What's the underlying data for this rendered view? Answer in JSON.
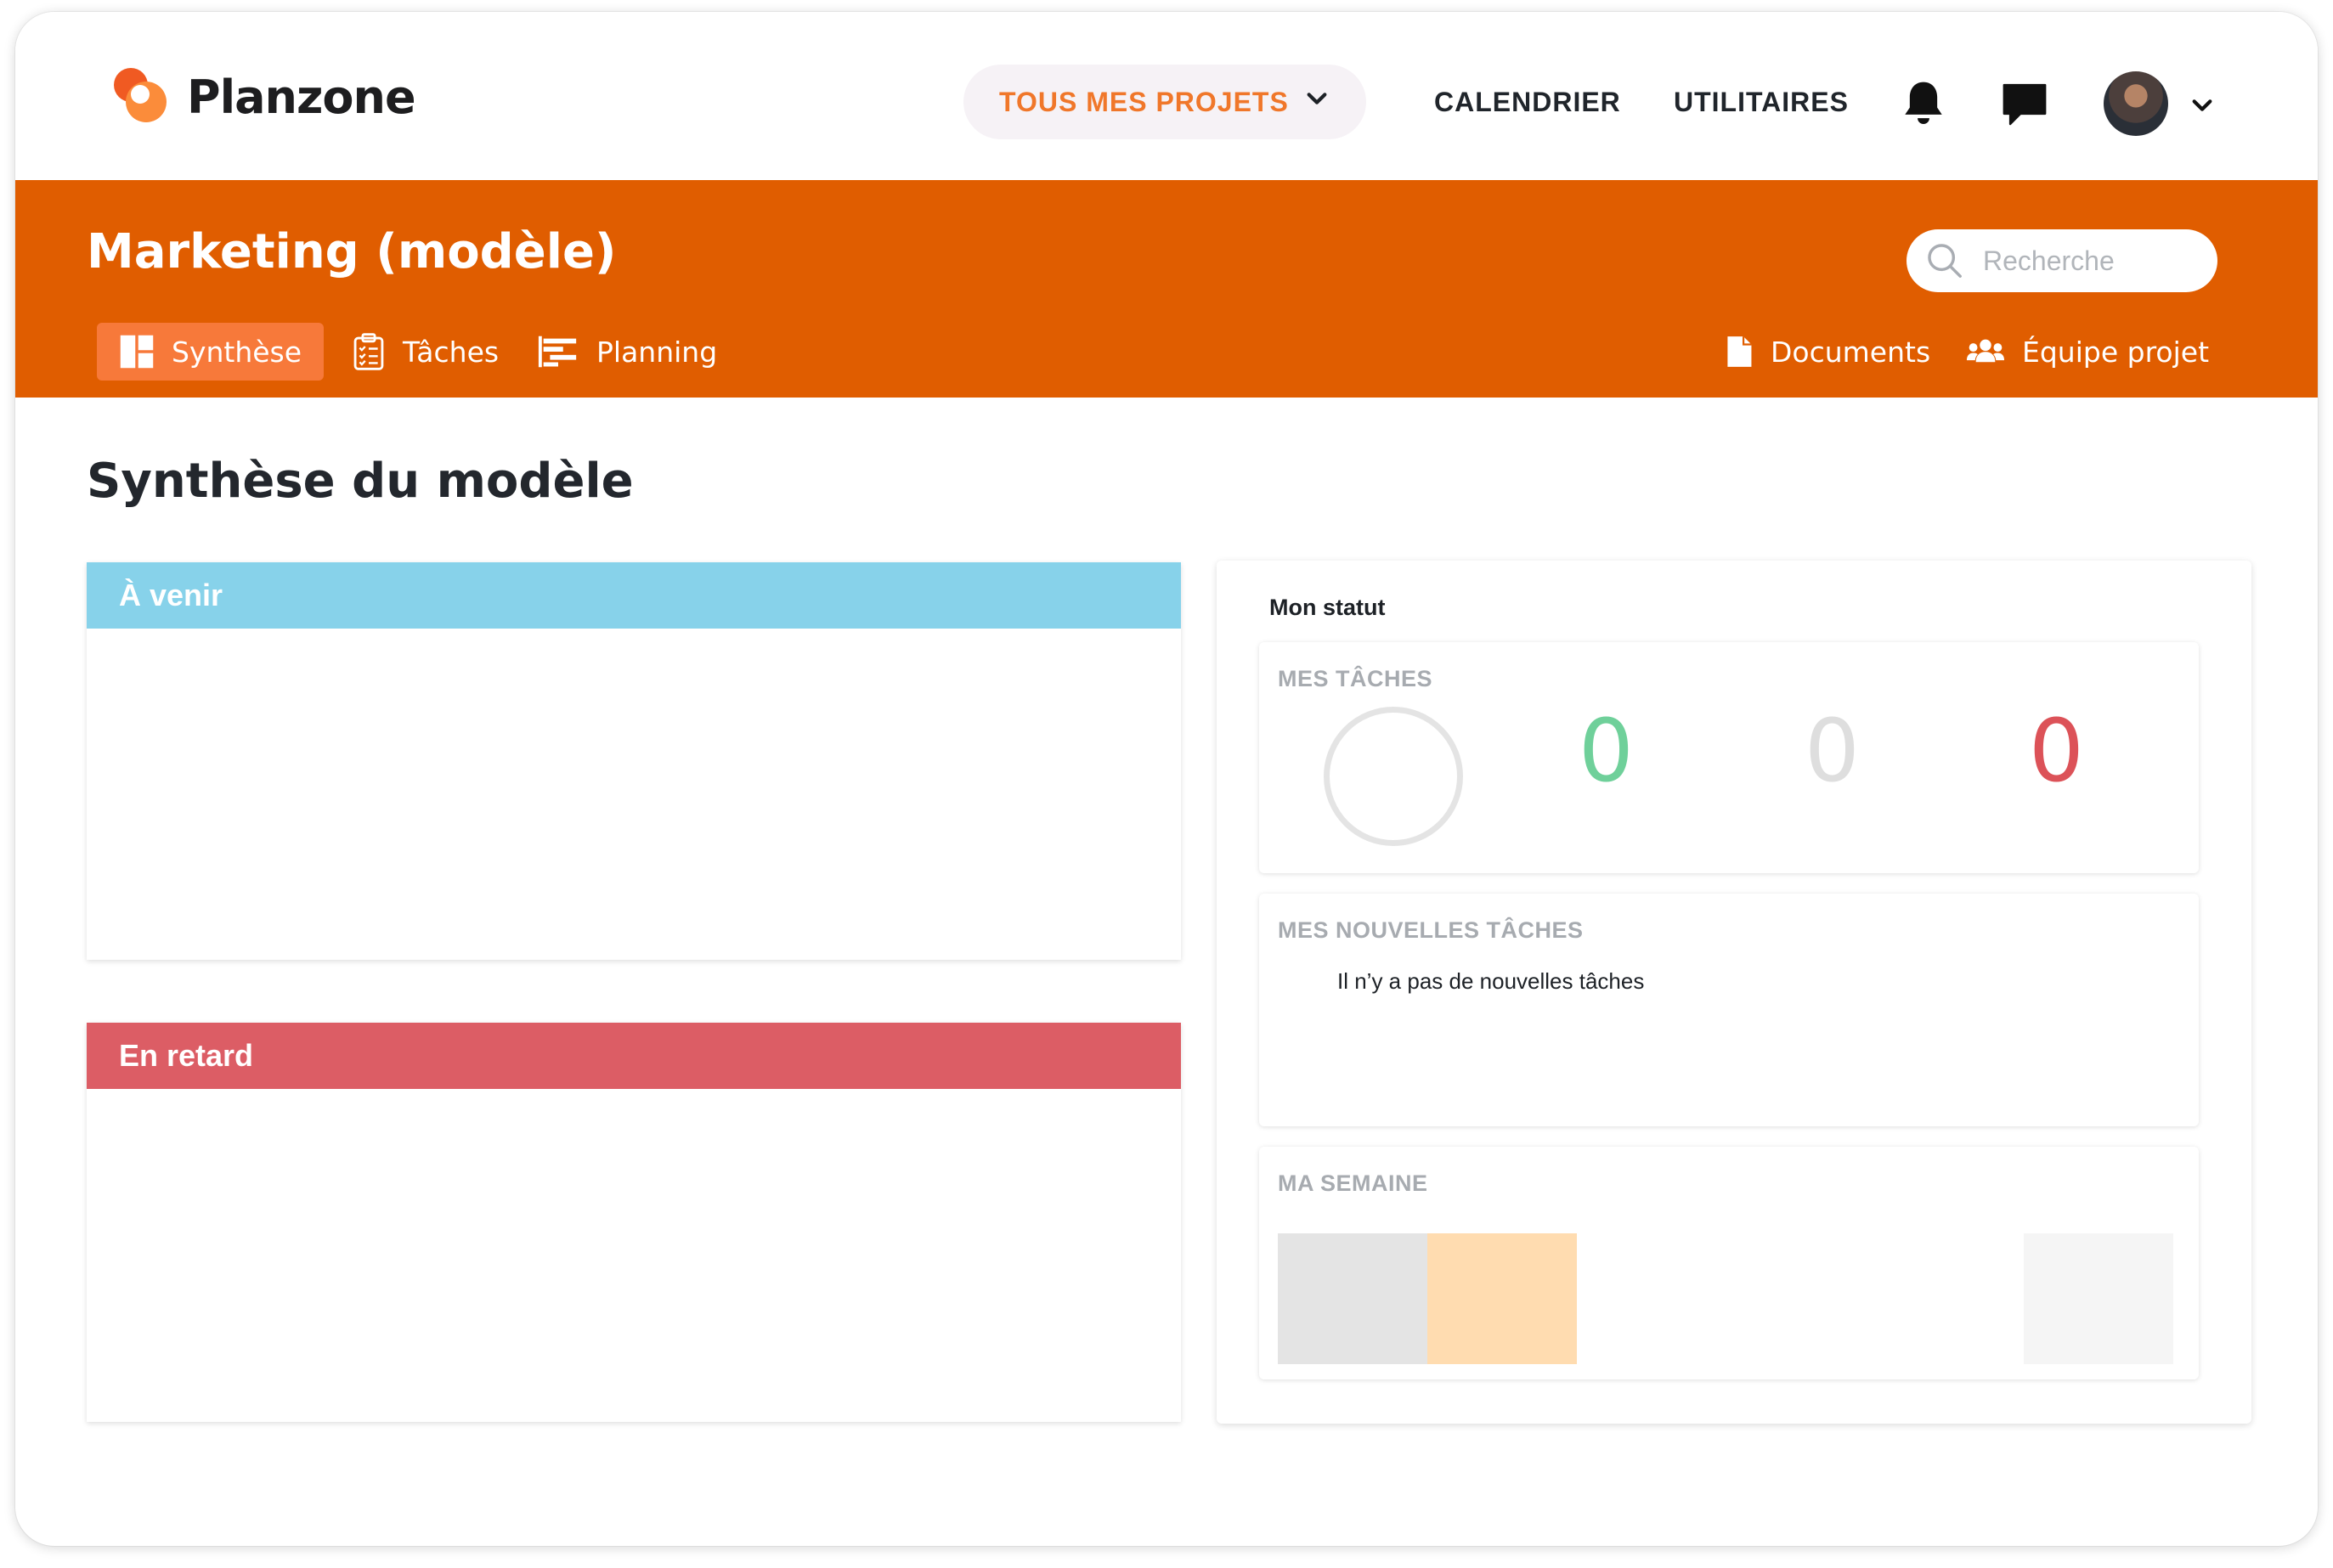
{
  "app": {
    "name": "Planzone"
  },
  "topnav": {
    "projects_label": "TOUS MES PROJETS",
    "calendar_label": "CALENDRIER",
    "utilities_label": "UTILITAIRES",
    "icons": [
      "bell-icon",
      "chat-icon",
      "avatar",
      "chevron-down-icon"
    ]
  },
  "project": {
    "title": "Marketing (modèle)",
    "search_placeholder": "Recherche",
    "tabs": [
      {
        "label": "Synthèse",
        "icon": "dashboard-icon",
        "active": true
      },
      {
        "label": "Tâches",
        "icon": "clipboard-icon",
        "active": false
      },
      {
        "label": "Planning",
        "icon": "gantt-icon",
        "active": false
      }
    ],
    "right_tabs": [
      {
        "label": "Documents",
        "icon": "document-icon"
      },
      {
        "label": "Équipe projet",
        "icon": "team-icon"
      }
    ]
  },
  "content": {
    "title": "Synthèse du modèle",
    "upcoming_title": "À venir",
    "late_title": "En retard"
  },
  "status": {
    "title": "Mon statut",
    "my_tasks_title": "MES TÂCHES",
    "counts": {
      "done": "0",
      "todo": "0",
      "late": "0"
    },
    "new_tasks_title": "MES NOUVELLES TÂCHES",
    "new_tasks_empty": "Il n’y a pas de nouvelles tâches",
    "week_title": "MA SEMAINE"
  },
  "colors": {
    "brand_orange": "#e05d00",
    "active_tab": "#f7793a",
    "upcoming_header": "#87d2ea",
    "late_header": "#dc5d65",
    "count_done": "#6fd09a",
    "count_todo": "#dedede",
    "count_late": "#dc5258"
  }
}
